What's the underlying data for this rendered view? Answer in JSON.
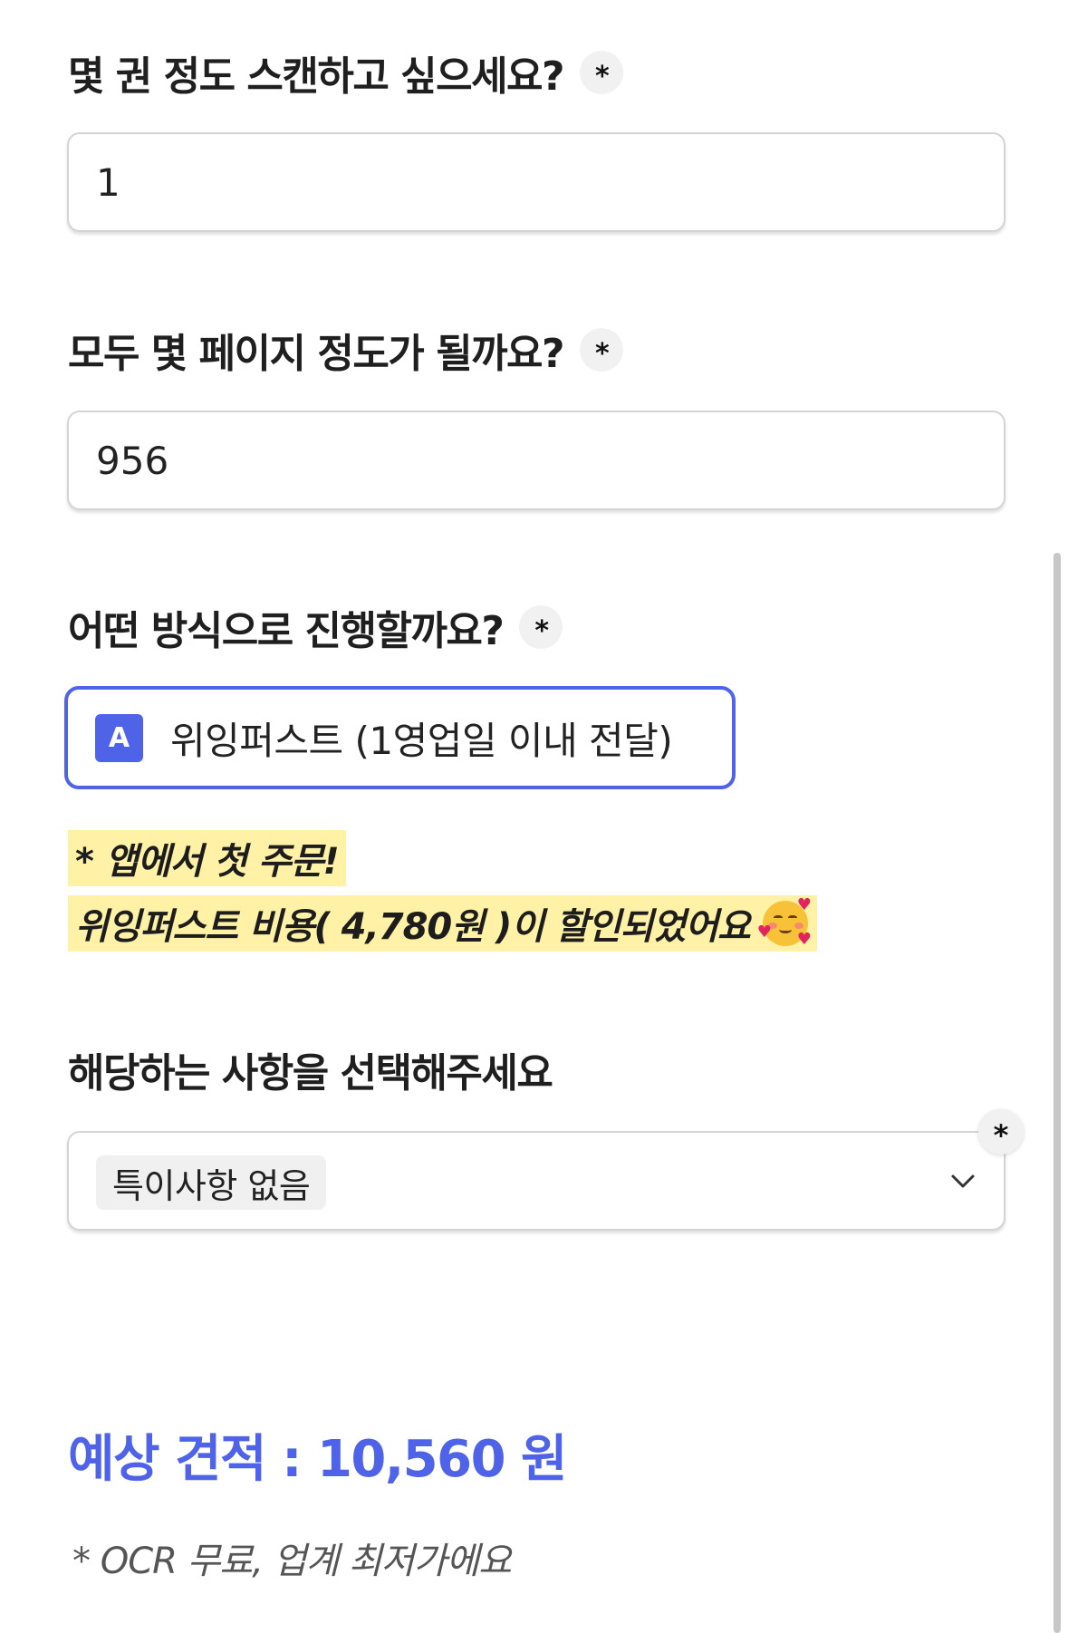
{
  "form": {
    "q1": {
      "label": "몇 권 정도 스캔하고 싶으세요?",
      "required_mark": "*",
      "value": "1"
    },
    "q2": {
      "label": "모두 몇 페이지 정도가 될까요?",
      "required_mark": "*",
      "value": "956"
    },
    "q3": {
      "label": "어떤 방식으로 진행할까요?",
      "required_mark": "*",
      "selected_key": "A",
      "selected_label": "위잉퍼스트 (1영업일 이내 전달)"
    },
    "promo": {
      "line1": "* 앱에서 첫 주문!",
      "line2": "위잉퍼스트 비용( 4,780원 )이 할인되었어요"
    },
    "q4": {
      "label": "해당하는 사항을 선택해주세요",
      "required_mark": "*",
      "selected_option": "특이사항 없음"
    }
  },
  "estimate": {
    "text": "예상 견적 : 10,560 원"
  },
  "note": "* OCR 무료, 업계 최저가에요",
  "colors": {
    "accent": "#4f63e8",
    "highlight": "#fff1a6",
    "border": "#d4d4d4"
  },
  "icons": {
    "emoji": "smiling-face-with-hearts-icon",
    "dropdown": "chevron-down-icon"
  }
}
